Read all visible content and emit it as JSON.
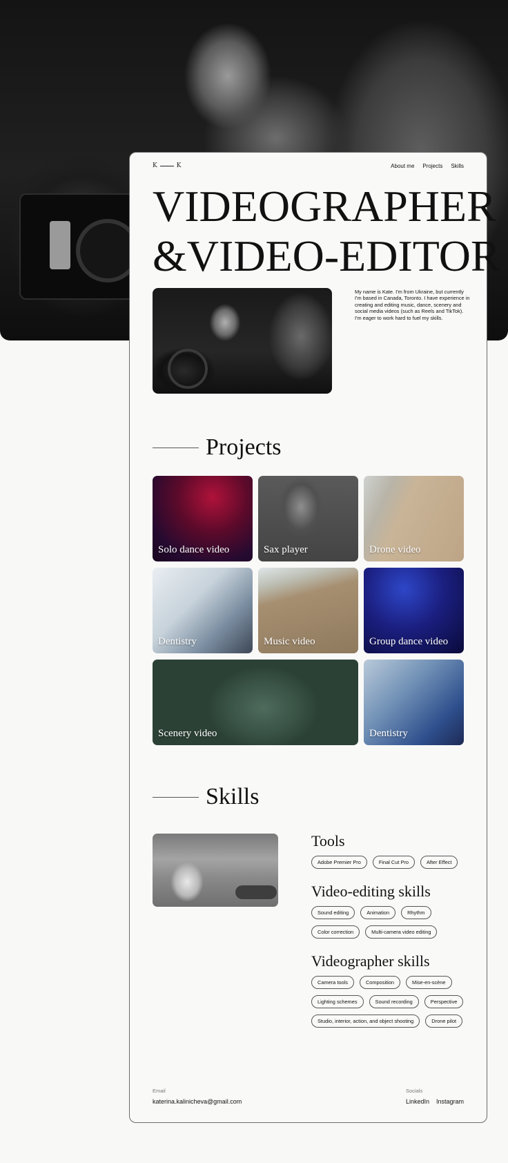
{
  "nav": {
    "logo_left": "K",
    "logo_right": "K",
    "links": [
      "About me",
      "Projects",
      "Skills"
    ]
  },
  "hero": {
    "line1": "VIDEOGRAPHER",
    "line2": "&VIDEO-EDITOR",
    "intro": "My name is Kate. I'm from Ukraine, but currently I'm based in Canada, Toronto. I have experience in creating and editing music, dance, scenery and social media videos (such as Reels and TikTok). I'm eager to work hard  to fuel my skills."
  },
  "projects": {
    "title": "Projects",
    "items": [
      {
        "label": "Solo dance video"
      },
      {
        "label": "Sax player"
      },
      {
        "label": "Drone video"
      },
      {
        "label": "Dentistry"
      },
      {
        "label": "Music video"
      },
      {
        "label": "Group dance video"
      },
      {
        "label": "Scenery video"
      },
      {
        "label": "Dentistry"
      }
    ]
  },
  "skills": {
    "title": "Skills",
    "tools": {
      "heading": "Tools",
      "items": [
        "Adobe Premier Pro",
        "Final Cut Pro",
        "After Effect"
      ]
    },
    "editing": {
      "heading": "Video-editing skills",
      "items": [
        "Sound editing",
        "Animation",
        "Rhythm",
        "Color correction",
        "Multi-camera video editing"
      ]
    },
    "videographer": {
      "heading": "Videographer skills",
      "items": [
        "Camera tools",
        "Composition",
        "Mise-en-scène",
        "Lighting schemes",
        "Sound recording",
        "Perspective",
        "Studio, interior, action, and object shooting",
        "Drone pilot"
      ]
    }
  },
  "footer": {
    "email_label": "Email",
    "email": "katerina.kalinicheva@gmail.com",
    "socials_label": "Socials",
    "socials": [
      "LinkedIn",
      "Instagram"
    ]
  }
}
